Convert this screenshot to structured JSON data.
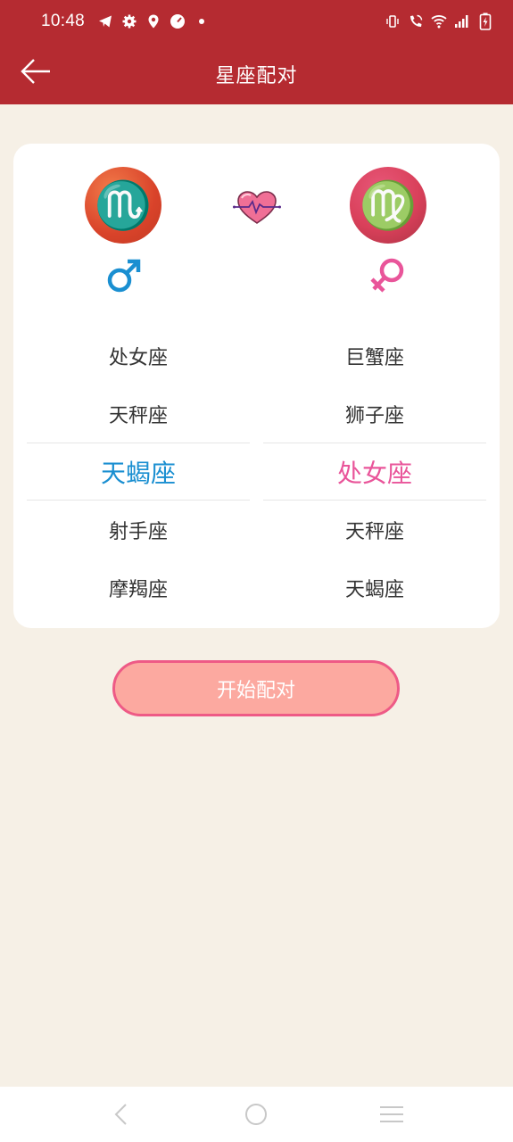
{
  "status_bar": {
    "time": "10:48",
    "left_icons": [
      "telegram-icon",
      "gear-icon",
      "location-icon",
      "speedometer-icon",
      "dot-icon"
    ],
    "right_icons": [
      "vibrate-icon",
      "wifi-call-icon",
      "wifi-icon",
      "signal-icon",
      "battery-charging-icon"
    ]
  },
  "app_bar": {
    "title": "星座配对",
    "back_icon": "arrow-left-icon"
  },
  "colors": {
    "primary": "#b52b31",
    "background": "#f6f0e6",
    "male_accent": "#1a8fd1",
    "female_accent": "#e9559a",
    "button_fill": "#fca9a0",
    "button_border": "#ee5a86"
  },
  "match": {
    "left": {
      "badge_icon": "scorpio-icon",
      "badge_glyph": "♏",
      "gender_icon": "male-icon",
      "items": [
        "处女座",
        "天秤座",
        "天蝎座",
        "射手座",
        "摩羯座"
      ],
      "selected": "天蝎座"
    },
    "right": {
      "badge_icon": "virgo-icon",
      "badge_glyph": "♍",
      "gender_icon": "female-icon",
      "items": [
        "巨蟹座",
        "狮子座",
        "处女座",
        "天秤座",
        "天蝎座"
      ],
      "selected": "处女座"
    },
    "heart_icon": "heartbeat-icon"
  },
  "button": {
    "label": "开始配对"
  },
  "nav_bar": {
    "items": [
      "back-nav-icon",
      "home-nav-icon",
      "recents-nav-icon"
    ]
  }
}
